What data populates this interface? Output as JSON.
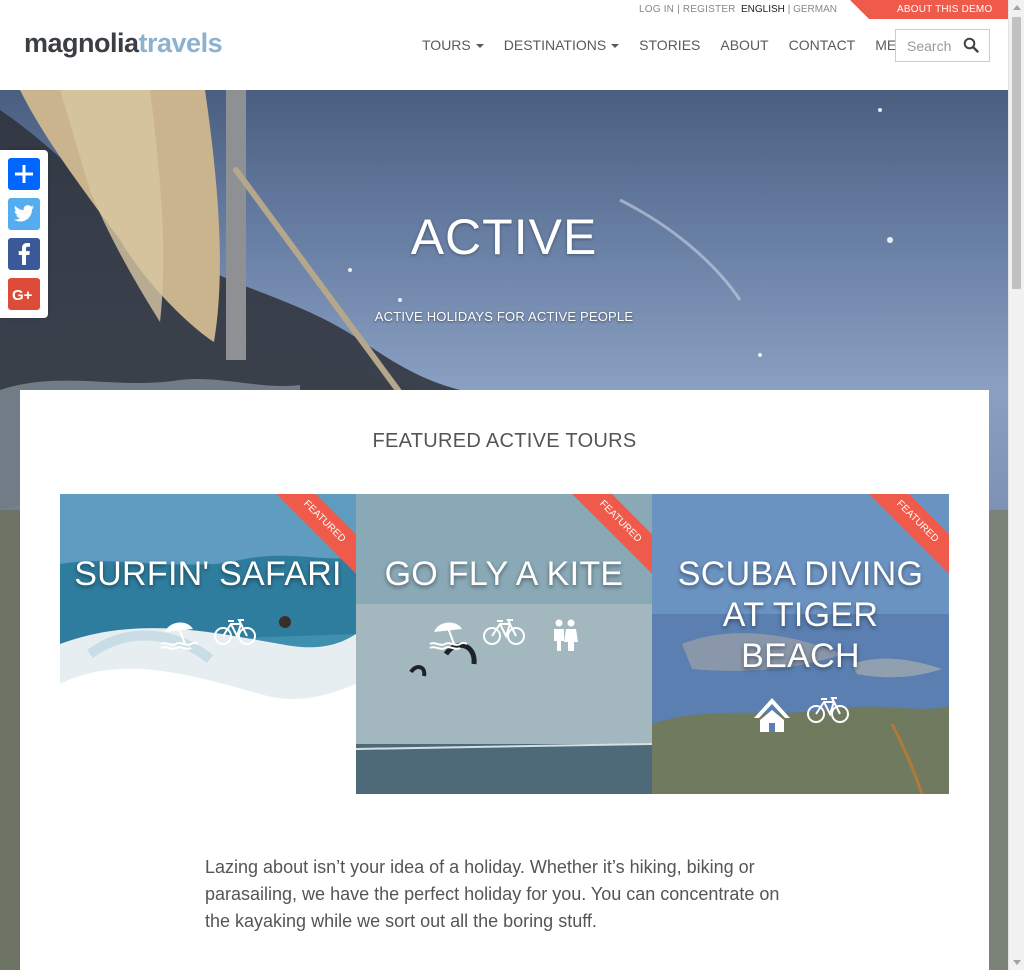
{
  "topbar": {
    "login": "LOG IN",
    "separator": "|",
    "register": "REGISTER",
    "lang_active": "ENGLISH",
    "lang_other": "GERMAN",
    "demo": "ABOUT THIS DEMO"
  },
  "logo": {
    "part1": "magnolia",
    "part2": "travels"
  },
  "nav": {
    "tours": "TOURS",
    "destinations": "DESTINATIONS",
    "stories": "STORIES",
    "about": "ABOUT",
    "contact": "CONTACT",
    "members": "MEMBERS"
  },
  "search": {
    "placeholder": "Search"
  },
  "hero": {
    "title": "ACTIVE",
    "subtitle": "ACTIVE HOLIDAYS FOR ACTIVE PEOPLE"
  },
  "share": {
    "items": [
      "share-icon",
      "twitter-icon",
      "facebook-icon",
      "google-plus-icon"
    ],
    "colors": {
      "share": "#0166ff",
      "twitter": "#55acee",
      "facebook": "#3b5998",
      "google": "#dd4b39"
    }
  },
  "section": {
    "title": "FEATURED ACTIVE TOURS"
  },
  "cards": [
    {
      "title": "SURFIN' SAFARI",
      "badge": "FEATURED",
      "icons": [
        "beach-icon",
        "bicycle-icon"
      ]
    },
    {
      "title": "GO FLY A KITE",
      "badge": "FEATURED",
      "icons": [
        "beach-icon",
        "bicycle-icon",
        "couple-icon"
      ]
    },
    {
      "title": "SCUBA DIVING AT TIGER BEACH",
      "badge": "FEATURED",
      "icons": [
        "mountain-cabin-icon",
        "bicycle-icon"
      ]
    }
  ],
  "intro": "Lazing about isn’t your idea of a holiday. Whether it’s hiking, biking or parasailing, we have the perfect holiday for you. You can concentrate on the kayaking while we sort out all the boring stuff.",
  "colors": {
    "accent": "#f05a4a",
    "logo_dark": "#3b3f44",
    "logo_light": "#8db2cf"
  }
}
